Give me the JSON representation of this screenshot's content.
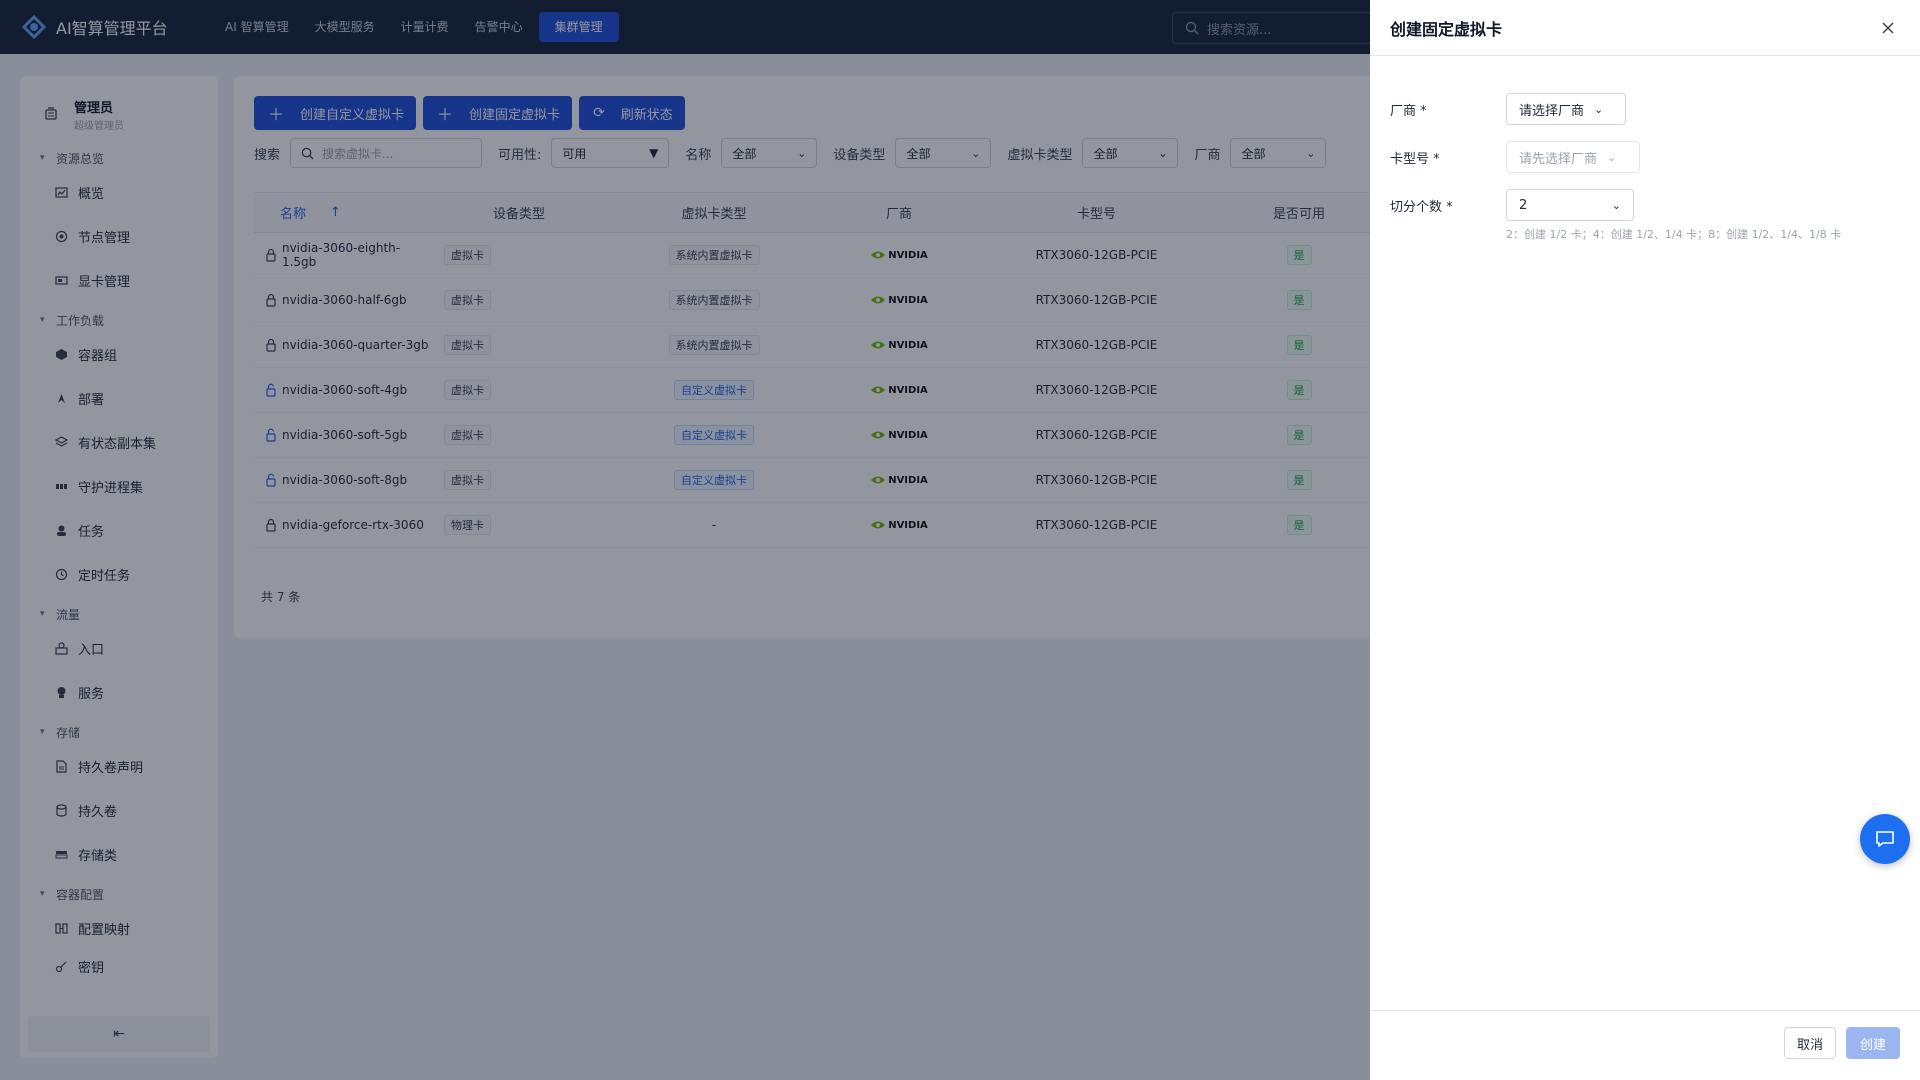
{
  "app": {
    "title": "AI智算管理平台"
  },
  "nav": [
    {
      "label": "AI 智算管理"
    },
    {
      "label": "大模型服务"
    },
    {
      "label": "计量计费"
    },
    {
      "label": "告警中心"
    },
    {
      "label": "集群管理"
    }
  ],
  "top_search": {
    "placeholder": "搜索资源..."
  },
  "user": {
    "name": "管理员",
    "role": "超级管理员"
  },
  "sidebar": {
    "groups": [
      {
        "title": "资源总览",
        "items": [
          {
            "label": "概览",
            "icon": "chart-icon"
          },
          {
            "label": "节点管理",
            "icon": "node-icon"
          },
          {
            "label": "显卡管理",
            "icon": "gpu-icon"
          }
        ]
      },
      {
        "title": "工作负载",
        "items": [
          {
            "label": "容器组",
            "icon": "cube-icon"
          },
          {
            "label": "部署",
            "icon": "deploy-icon"
          },
          {
            "label": "有状态副本集",
            "icon": "layers-icon"
          },
          {
            "label": "守护进程集",
            "icon": "daemon-icon"
          },
          {
            "label": "任务",
            "icon": "task-icon"
          },
          {
            "label": "定时任务",
            "icon": "clock-icon"
          }
        ]
      },
      {
        "title": "流量",
        "items": [
          {
            "label": "入口",
            "icon": "ingress-icon"
          },
          {
            "label": "服务",
            "icon": "service-icon"
          }
        ]
      },
      {
        "title": "存储",
        "items": [
          {
            "label": "持久卷声明",
            "icon": "file-icon"
          },
          {
            "label": "持久卷",
            "icon": "database-icon"
          },
          {
            "label": "存储类",
            "icon": "storage-icon"
          }
        ]
      },
      {
        "title": "容器配置",
        "items": [
          {
            "label": "配置映射",
            "icon": "config-icon"
          },
          {
            "label": "密钥",
            "icon": "key-icon"
          }
        ]
      }
    ],
    "collapse_icon": "⇤"
  },
  "actions": {
    "create_custom": "创建自定义虚拟卡",
    "create_fixed": "创建固定虚拟卡",
    "refresh": "刷新状态"
  },
  "filters": {
    "search_label": "搜索",
    "search_placeholder": "搜索虚拟卡...",
    "availability_label": "可用性:",
    "availability_value": "可用",
    "name_label": "名称",
    "name_value": "全部",
    "device_type_label": "设备类型",
    "device_type_value": "全部",
    "vcard_type_label": "虚拟卡类型",
    "vcard_type_value": "全部",
    "vendor_label": "厂商",
    "vendor_value": "全部"
  },
  "table": {
    "columns": {
      "name": "名称",
      "sort": "↑",
      "device_type": "设备类型",
      "vcard_type": "虚拟卡类型",
      "vendor": "厂商",
      "model": "卡型号",
      "available": "是否可用"
    },
    "rows": [
      {
        "name": "nvidia-3060-eighth-1.5gb",
        "device_type": "虚拟卡",
        "vcard_type": "系统内置虚拟卡",
        "vcard_style": "gray",
        "vendor": "NVIDIA",
        "model": "RTX3060-12GB-PCIE",
        "available": "是",
        "lock": "closed"
      },
      {
        "name": "nvidia-3060-half-6gb",
        "device_type": "虚拟卡",
        "vcard_type": "系统内置虚拟卡",
        "vcard_style": "gray",
        "vendor": "NVIDIA",
        "model": "RTX3060-12GB-PCIE",
        "available": "是",
        "lock": "closed"
      },
      {
        "name": "nvidia-3060-quarter-3gb",
        "device_type": "虚拟卡",
        "vcard_type": "系统内置虚拟卡",
        "vcard_style": "gray",
        "vendor": "NVIDIA",
        "model": "RTX3060-12GB-PCIE",
        "available": "是",
        "lock": "closed"
      },
      {
        "name": "nvidia-3060-soft-4gb",
        "device_type": "虚拟卡",
        "vcard_type": "自定义虚拟卡",
        "vcard_style": "blue",
        "vendor": "NVIDIA",
        "model": "RTX3060-12GB-PCIE",
        "available": "是",
        "lock": "open"
      },
      {
        "name": "nvidia-3060-soft-5gb",
        "device_type": "虚拟卡",
        "vcard_type": "自定义虚拟卡",
        "vcard_style": "blue",
        "vendor": "NVIDIA",
        "model": "RTX3060-12GB-PCIE",
        "available": "是",
        "lock": "open"
      },
      {
        "name": "nvidia-3060-soft-8gb",
        "device_type": "虚拟卡",
        "vcard_type": "自定义虚拟卡",
        "vcard_style": "blue",
        "vendor": "NVIDIA",
        "model": "RTX3060-12GB-PCIE",
        "available": "是",
        "lock": "open"
      },
      {
        "name": "nvidia-geforce-rtx-3060",
        "device_type": "物理卡",
        "vcard_type": "-",
        "vcard_style": "none",
        "vendor": "NVIDIA",
        "model": "RTX3060-12GB-PCIE",
        "available": "是",
        "lock": "closed"
      }
    ],
    "total": "共 7 条"
  },
  "drawer": {
    "title": "创建固定虚拟卡",
    "vendor_label": "厂商 *",
    "vendor_placeholder": "请选择厂商",
    "model_label": "卡型号 *",
    "model_placeholder": "请先选择厂商",
    "split_label": "切分个数 *",
    "split_value": "2",
    "split_hint": "2：创建 1/2 卡；4：创建 1/2、1/4 卡；8：创建 1/2、1/4、1/8 卡",
    "cancel": "取消",
    "create": "创建"
  },
  "colors": {
    "topbar": "#16233a",
    "primary": "#1d4ed8",
    "nvidia_green": "#76b900",
    "available_green": "#16a34a",
    "overlay": "rgba(15,23,42,0.45)"
  }
}
